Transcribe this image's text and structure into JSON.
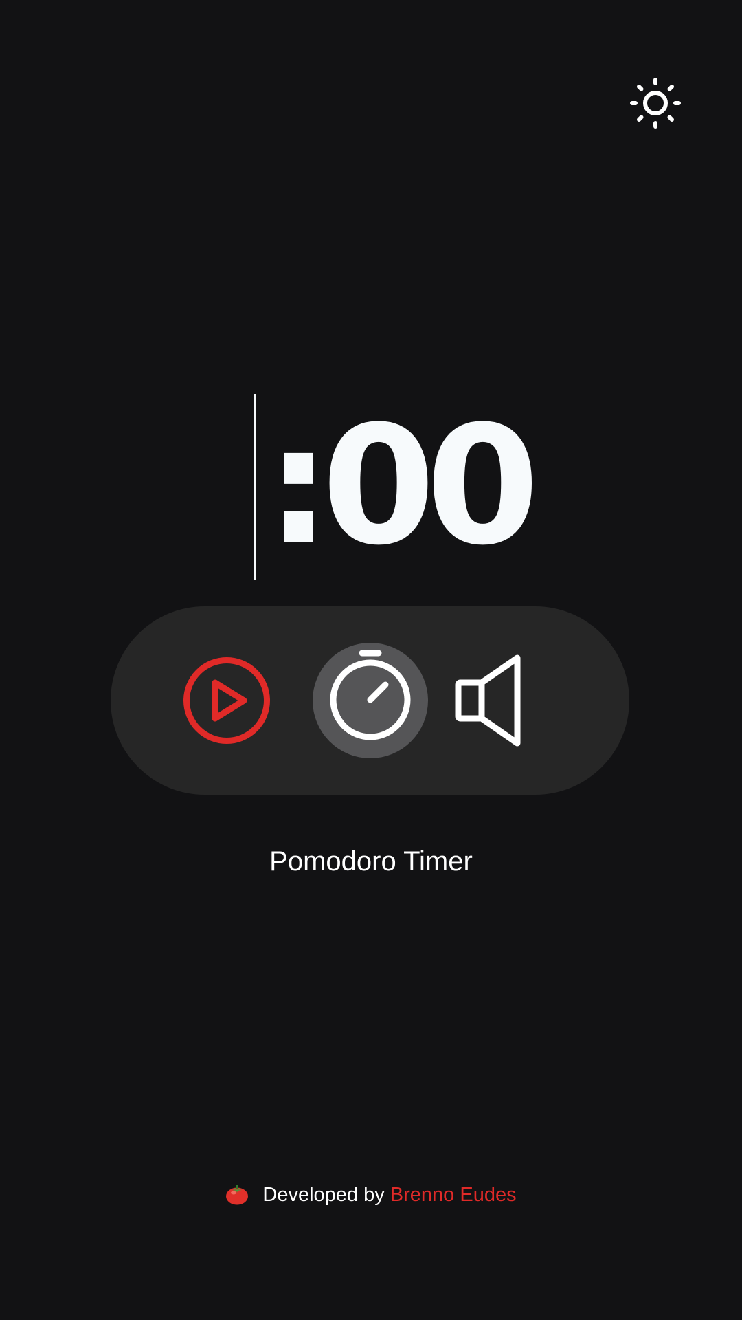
{
  "header": {
    "theme_toggle_icon": "sun-icon"
  },
  "timer": {
    "display": ":00"
  },
  "controls": {
    "play_icon": "play-circle-icon",
    "stopwatch_icon": "stopwatch-icon",
    "sound_icon": "speaker-icon"
  },
  "app": {
    "title": "Pomodoro Timer"
  },
  "footer": {
    "emoji_icon": "tomato-icon",
    "prefix": "Developed by ",
    "author": "Brenno Eudes"
  },
  "colors": {
    "background": "#121214",
    "controls_background": "#262626",
    "active_button": "#555557",
    "accent": "#e02a28",
    "text": "#ffffff"
  }
}
